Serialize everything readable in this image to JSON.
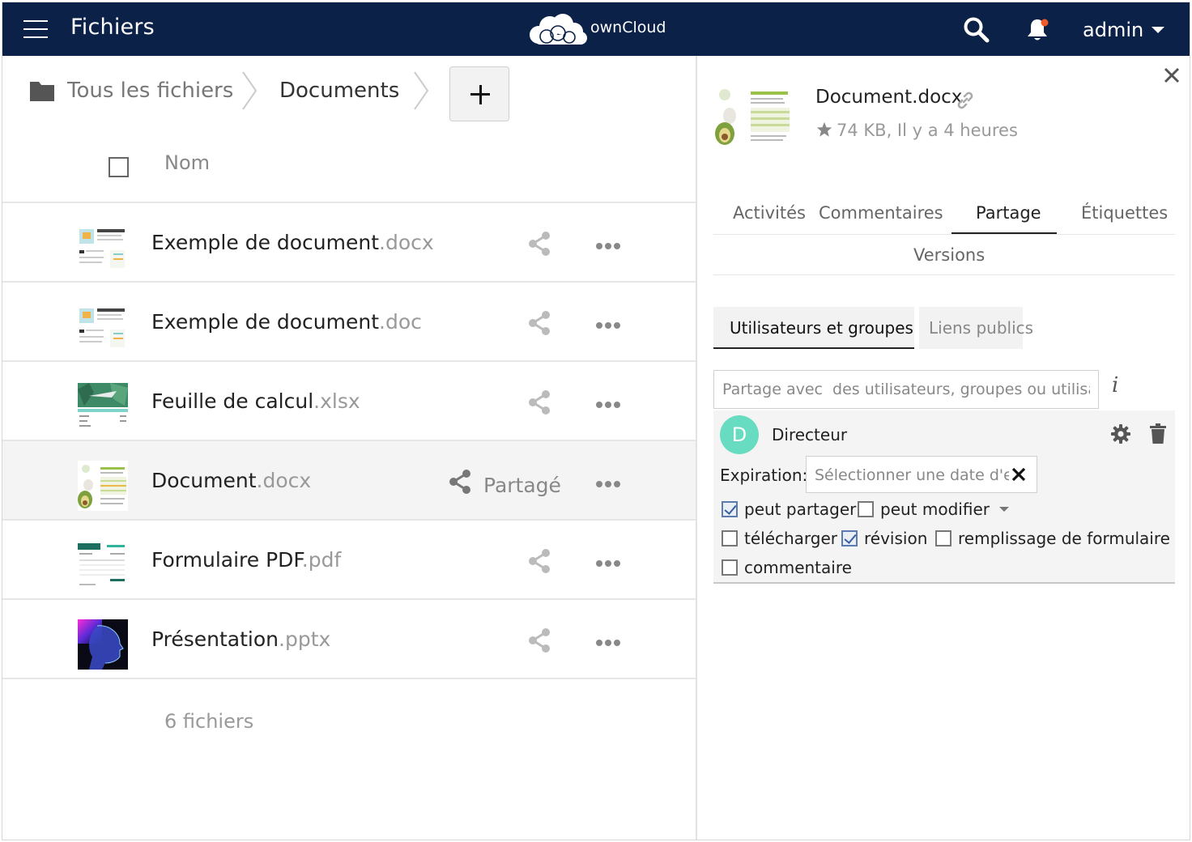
{
  "header": {
    "app_title": "Fichiers",
    "brand": "ownCloud",
    "user": "admin",
    "bg_color": "#0b2148",
    "notification_dot_color": "#f05a28"
  },
  "breadcrumb": {
    "home": "Tous les fichiers",
    "current": "Documents"
  },
  "list": {
    "column_name": "Nom",
    "files": [
      {
        "name": "Exemple de document",
        "ext": ".docx",
        "shared": false,
        "selected": false,
        "thumb": "doc-icon"
      },
      {
        "name": "Exemple de document",
        "ext": ".doc",
        "shared": false,
        "selected": false,
        "thumb": "doc-icon"
      },
      {
        "name": "Feuille de calcul",
        "ext": ".xlsx",
        "shared": false,
        "selected": false,
        "thumb": "spreadsheet-icon"
      },
      {
        "name": "Document",
        "ext": ".docx",
        "shared": true,
        "selected": true,
        "thumb": "food-doc-icon"
      },
      {
        "name": "Formulaire PDF",
        "ext": ".pdf",
        "shared": false,
        "selected": false,
        "thumb": "invoice-icon"
      },
      {
        "name": "Présentation",
        "ext": ".pptx",
        "shared": false,
        "selected": false,
        "thumb": "presentation-icon"
      }
    ],
    "shared_label": "Partagé",
    "footer": "6 fichiers"
  },
  "details": {
    "filename": "Document.docx",
    "meta": "74 KB, Il y a 4 heures",
    "tabs": [
      "Activités",
      "Commentaires",
      "Partage",
      "Étiquettes",
      "Versions"
    ],
    "active_tab": "Partage",
    "subtabs": {
      "users": "Utilisateurs et groupes",
      "links": "Liens publics"
    },
    "share_placeholder": "Partage avec  des utilisateurs, groupes ou utilisateurs fédérés",
    "sharee": {
      "initial": "D",
      "name": "Directeur",
      "avatar_color": "#67dcc1",
      "expiration_label": "Expiration:",
      "expiration_placeholder": "Sélectionner une date d'expiration"
    },
    "permissions": [
      {
        "label": "peut partager",
        "checked": true
      },
      {
        "label": "peut modifier",
        "checked": false
      },
      {
        "label": "télécharger",
        "checked": false
      },
      {
        "label": "révision",
        "checked": true
      },
      {
        "label": "remplissage de formulaire",
        "checked": false
      },
      {
        "label": "commentaire",
        "checked": false
      }
    ]
  }
}
